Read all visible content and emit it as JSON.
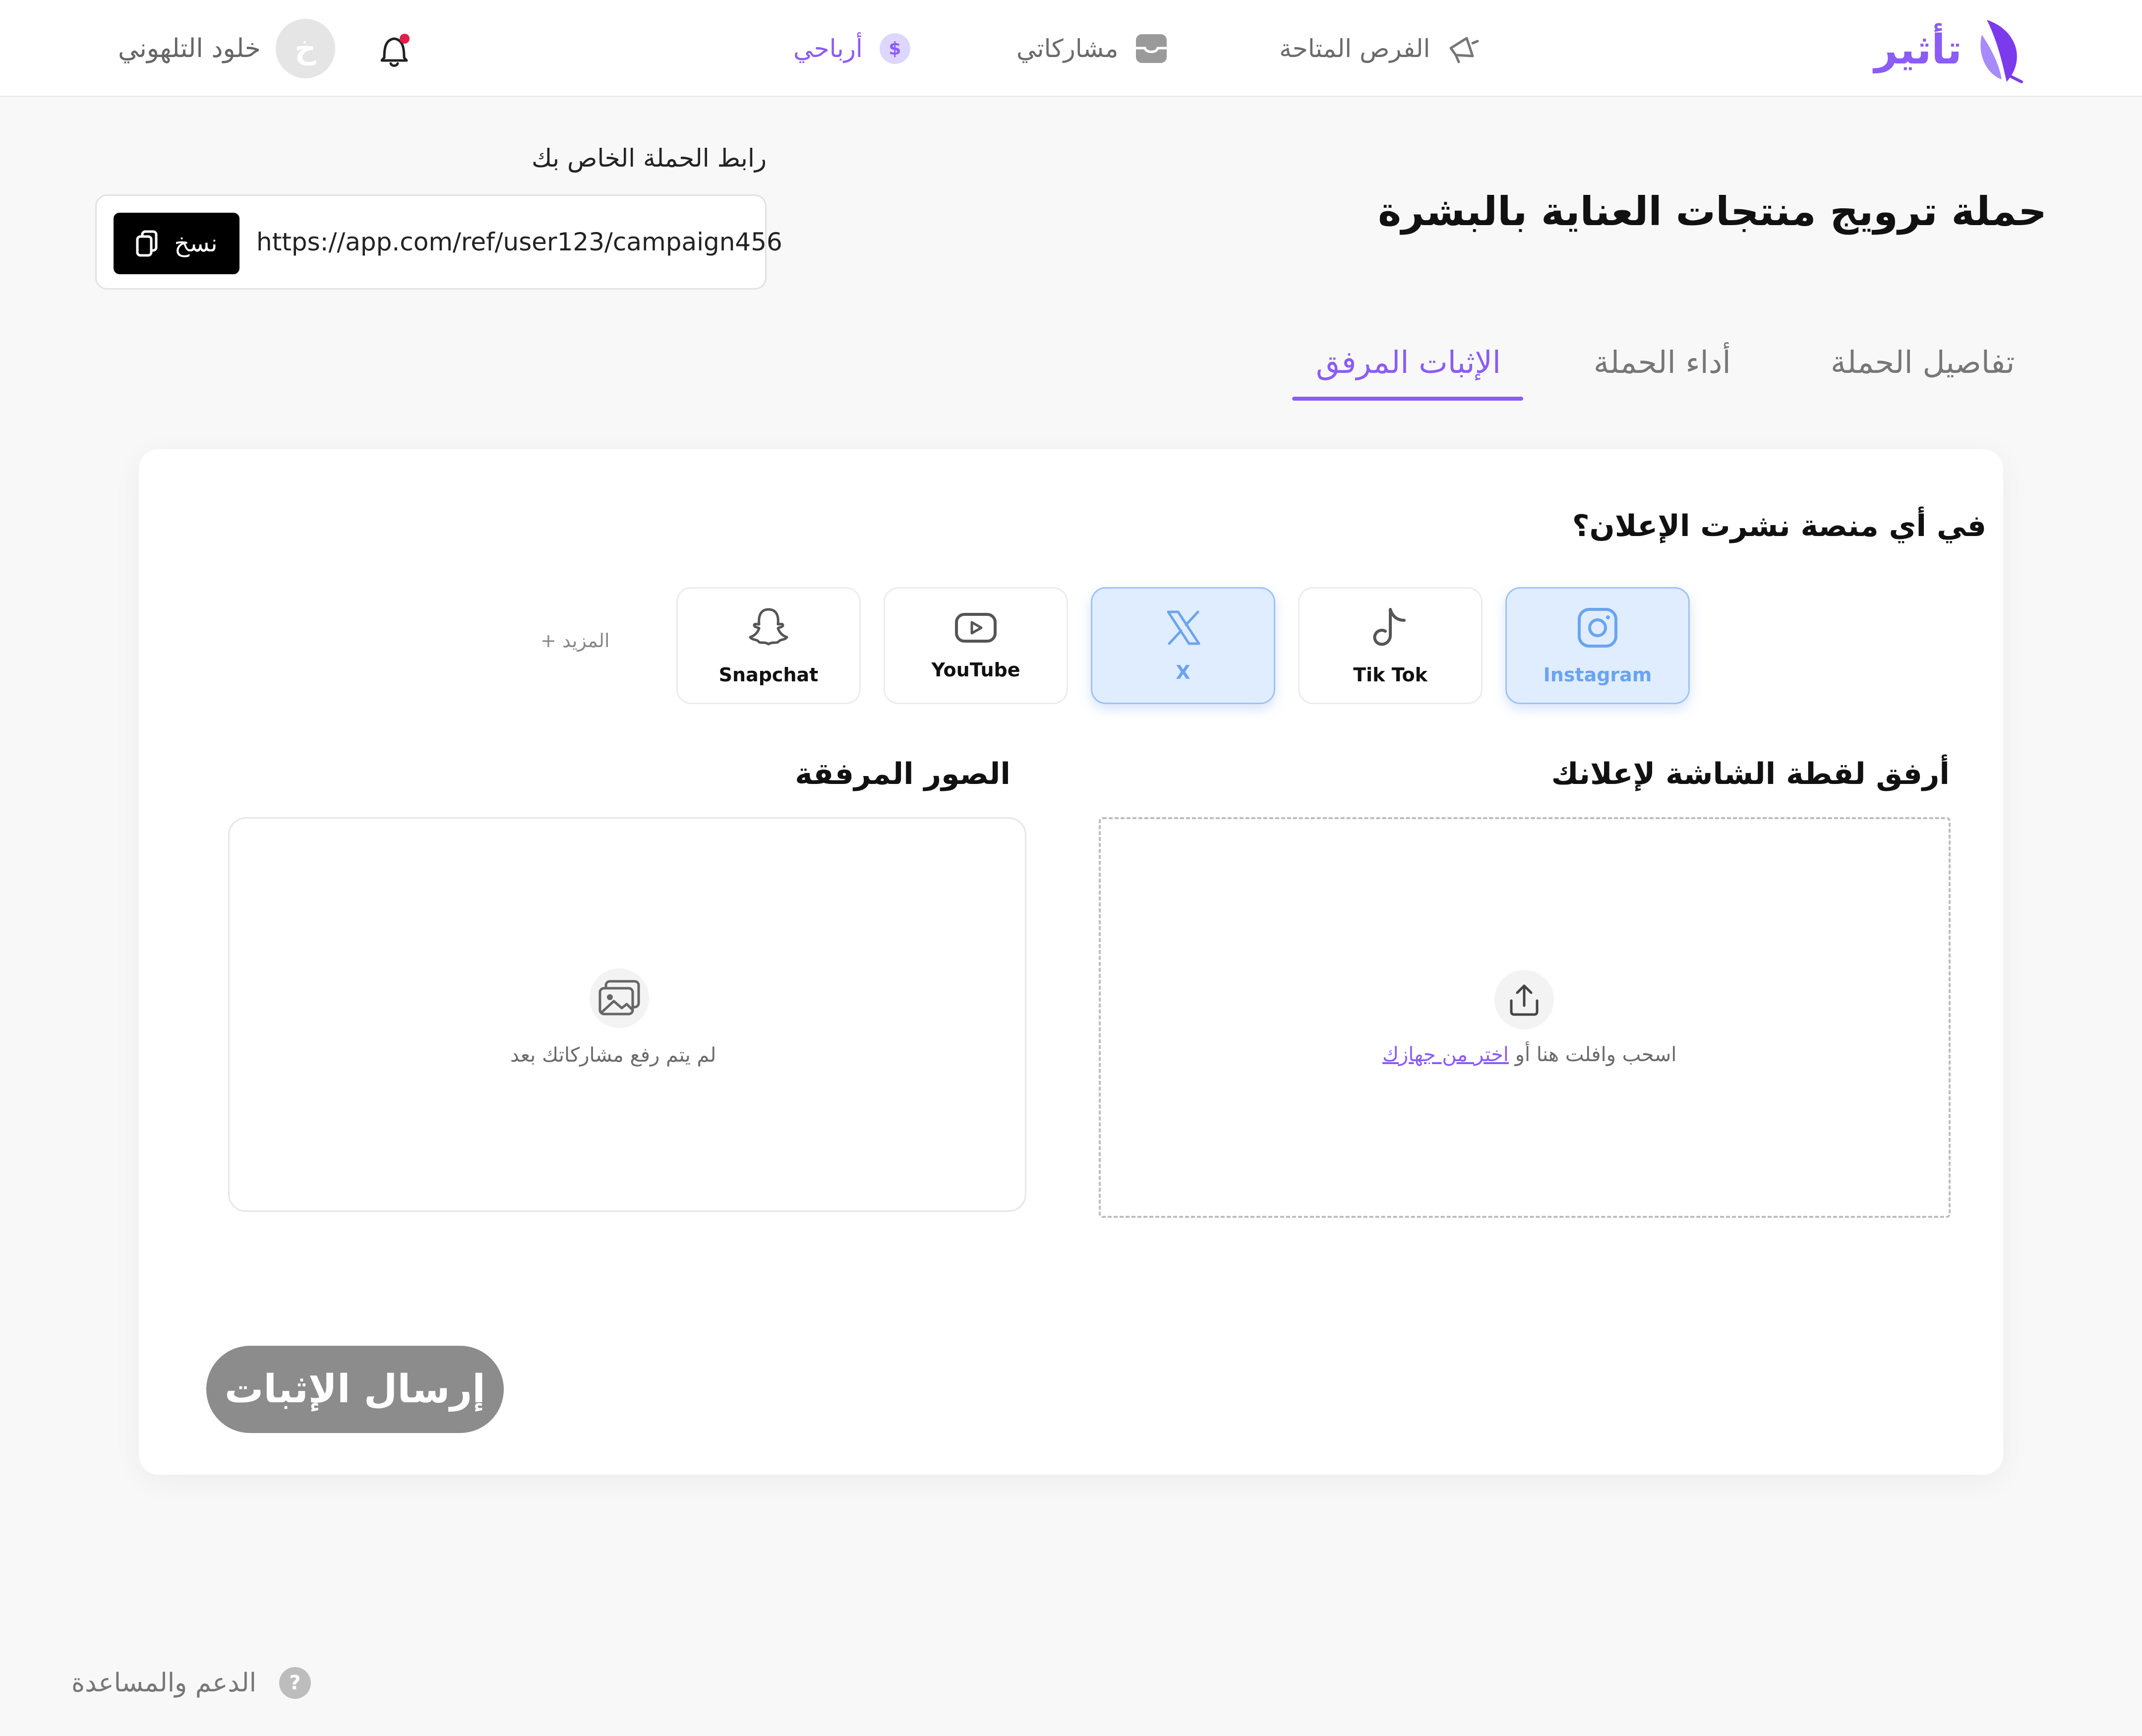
{
  "header": {
    "logo_text": "تأثير",
    "nav": [
      {
        "label": "الفرص المتاحة",
        "icon": "megaphone-icon"
      },
      {
        "label": "مشاركاتي",
        "icon": "tray-icon"
      },
      {
        "label": "أرباحي",
        "icon": "dollar-icon",
        "active": true
      }
    ],
    "dollar_symbol": "$",
    "user": {
      "name": "خلود التلهوني",
      "initial": "خ"
    },
    "notification_dot_color": "#e11d48"
  },
  "page": {
    "title": "حملة ترويج منتجات العناية بالبشرة",
    "link_label": "رابط الحملة الخاص بك",
    "link_url": "https://app.com/ref/user123/campaign456",
    "copy_label": "نسخ"
  },
  "tabs": [
    {
      "label": "تفاصيل الحملة"
    },
    {
      "label": "أداء الحملة"
    },
    {
      "label": "الإثبات المرفق",
      "active": true
    }
  ],
  "card": {
    "question": "في أي منصة نشرت الإعلان؟",
    "platforms": [
      {
        "label": "Instagram",
        "selected": true
      },
      {
        "label": "Tik Tok",
        "selected": false
      },
      {
        "label": "X",
        "selected": true
      },
      {
        "label": "YouTube",
        "selected": false
      },
      {
        "label": "Snapchat",
        "selected": false
      }
    ],
    "more_label": "المزيد +",
    "attach_heading": "أرفق لقطة الشاشة لإعلانك",
    "images_heading": "الصور المرفقة",
    "upload_text": "اسحب وافلت هنا أو",
    "upload_link": "اختر من جهازك",
    "empty_text": "لم يتم رفع مشاركاتك بعد",
    "submit_label": "إرسال الإثبات"
  },
  "footer": {
    "help_label": "الدعم والمساعدة",
    "help_symbol": "?"
  },
  "colors": {
    "accent": "#8b5cf6",
    "selected_bg": "#e0edff",
    "selected_text": "#6aa4ef",
    "submit_disabled": "#8c8c8c"
  }
}
